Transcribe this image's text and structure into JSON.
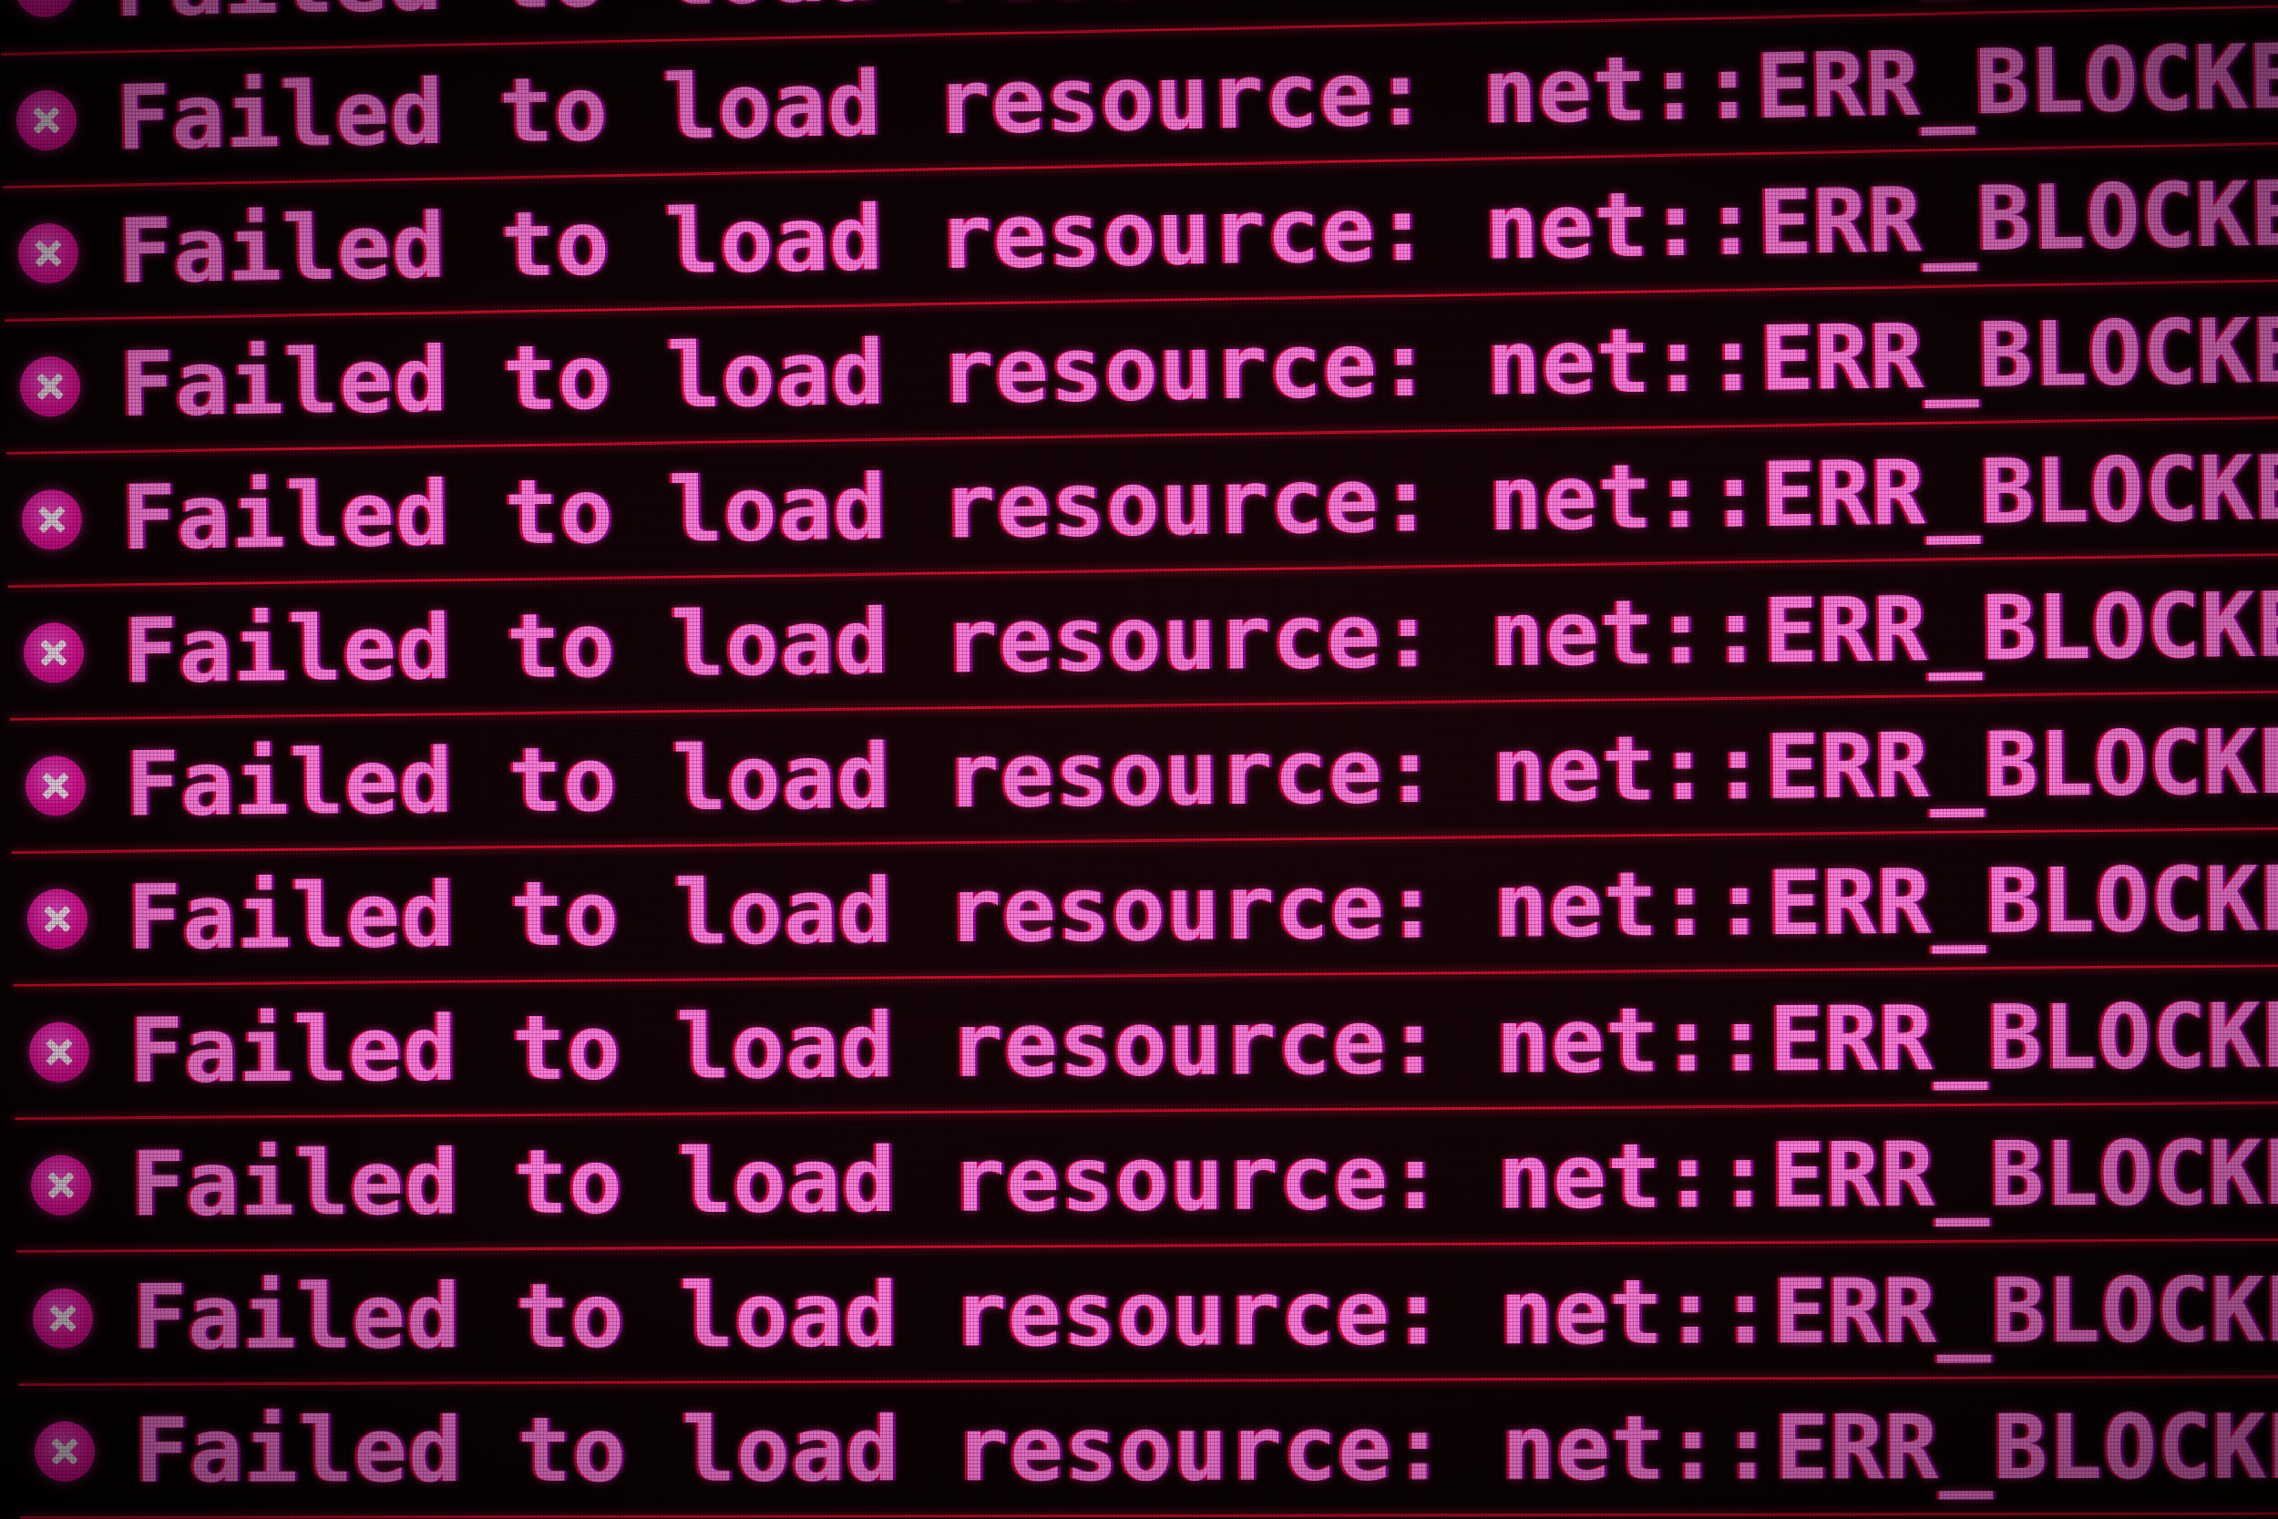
{
  "console": {
    "icon": "error-x-circle-icon",
    "accent_color": "#ff2fb4",
    "divider_color": "#c8102e",
    "entries": [
      {
        "message": "Failed to load resource: net::ERR_BLOCKED_BY_ADI"
      },
      {
        "message": "Failed to load resource: net::ERR_BLOCKED_BY_AD"
      },
      {
        "message": "Failed to load resource: net::ERR_BLOCKED_BY_AD"
      },
      {
        "message": "Failed to load resource: net::ERR_BLOCKED_BY_AD"
      },
      {
        "message": "Failed to load resource: net::ERR_BLOCKED_BY_AD"
      },
      {
        "message": "Failed to load resource: net::ERR_BLOCKED_BY_AD"
      },
      {
        "message": "Failed to load resource: net::ERR_BLOCKED_BY_AD"
      },
      {
        "message": "Failed to load resource: net::ERR_BLOCKED_BY_AD"
      },
      {
        "message": "Failed to load resource: net::ERR_BLOCKED_BY_AD"
      },
      {
        "message": "Failed to load resource: net::ERR_BLOCKED_BY_AD"
      },
      {
        "message": "Failed to load resource: net::ERR_BLOCKED_BY_AD"
      },
      {
        "message": "Failed to load resource: net::ERR_BLOCKED_BY_AD"
      }
    ]
  }
}
